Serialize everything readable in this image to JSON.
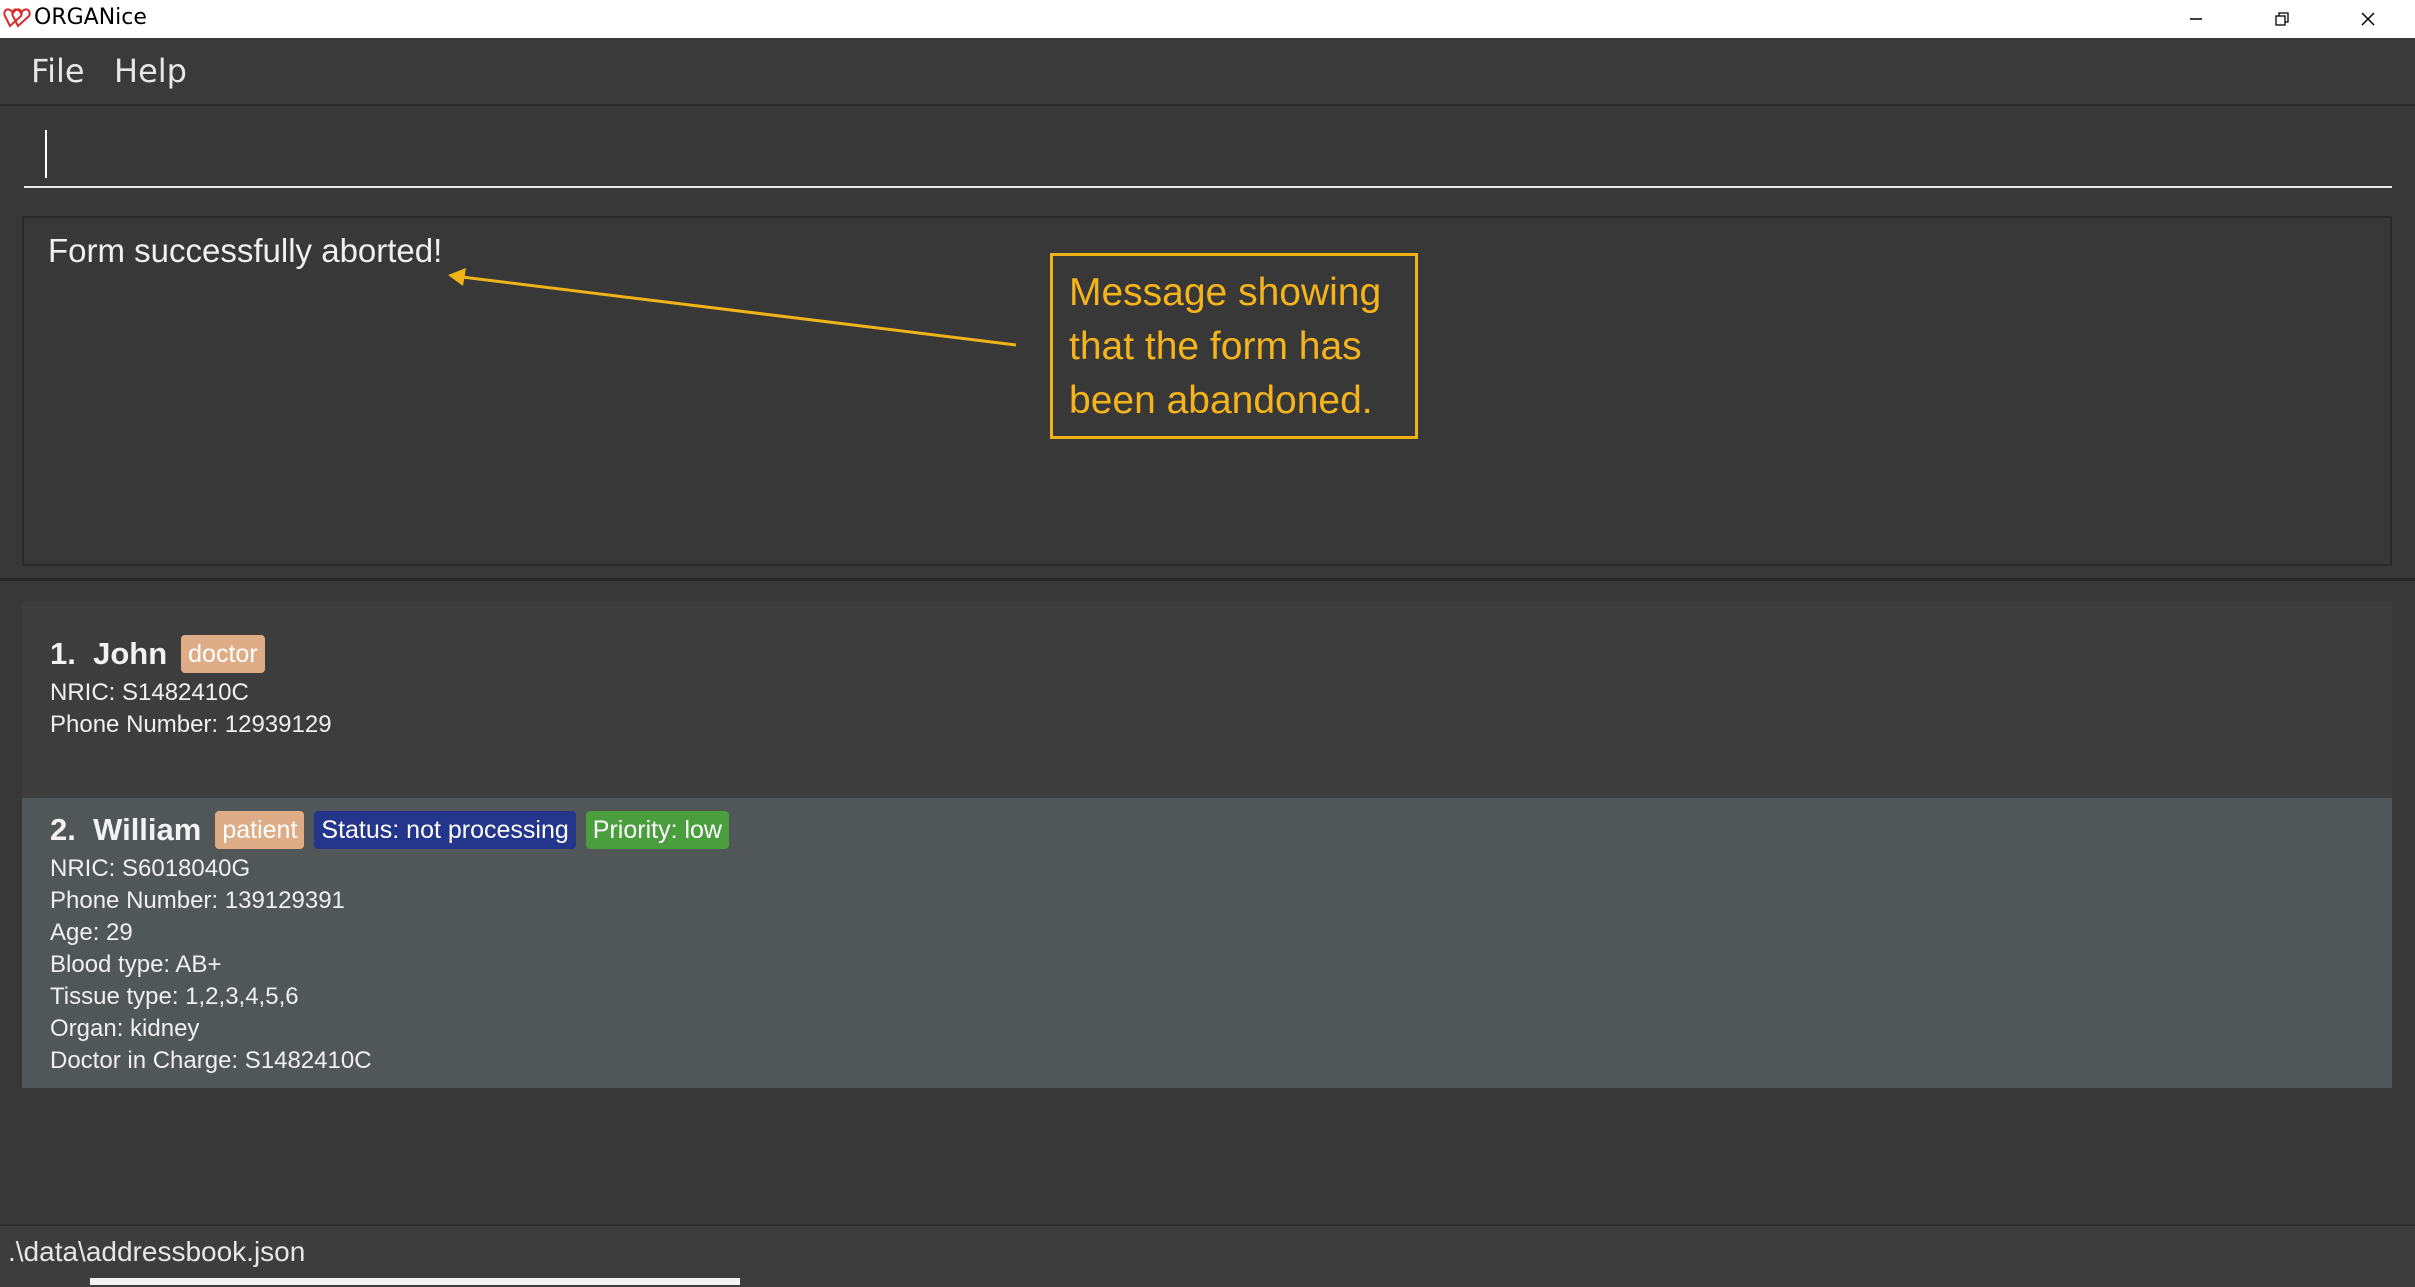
{
  "window": {
    "title": "ORGANice",
    "icon": "heart-icon",
    "controls": [
      "minimize-icon",
      "maximize-icon",
      "close-icon"
    ]
  },
  "menu": {
    "file": "File",
    "help": "Help"
  },
  "command": {
    "value": "",
    "placeholder": ""
  },
  "result": {
    "message": "Form successfully aborted!"
  },
  "annotation": {
    "text": "Message showing\nthat the form has\nbeen abandoned.",
    "color": "#f5b41b"
  },
  "persons": [
    {
      "index": "1.",
      "name": "John",
      "tags": [
        "doctor"
      ],
      "fields": [
        "NRIC: S1482410C",
        "Phone Number: 12939129"
      ]
    },
    {
      "index": "2.",
      "name": "William",
      "tags": [
        "patient",
        "Status: not processing",
        "Priority: low"
      ],
      "fields": [
        "NRIC: S6018040G",
        "Phone Number: 139129391",
        "Age: 29",
        "Blood type: AB+",
        "Tissue type: 1,2,3,4,5,6",
        "Organ: kidney",
        "Doctor in Charge: S1482410C"
      ]
    }
  ],
  "status": {
    "path": ".\\data\\addressbook.json"
  },
  "colors": {
    "background": "#383838",
    "tag_role": "#deac86",
    "tag_status": "#24358c",
    "tag_priority": "#4a9e3d",
    "selected_card": "#515658"
  }
}
